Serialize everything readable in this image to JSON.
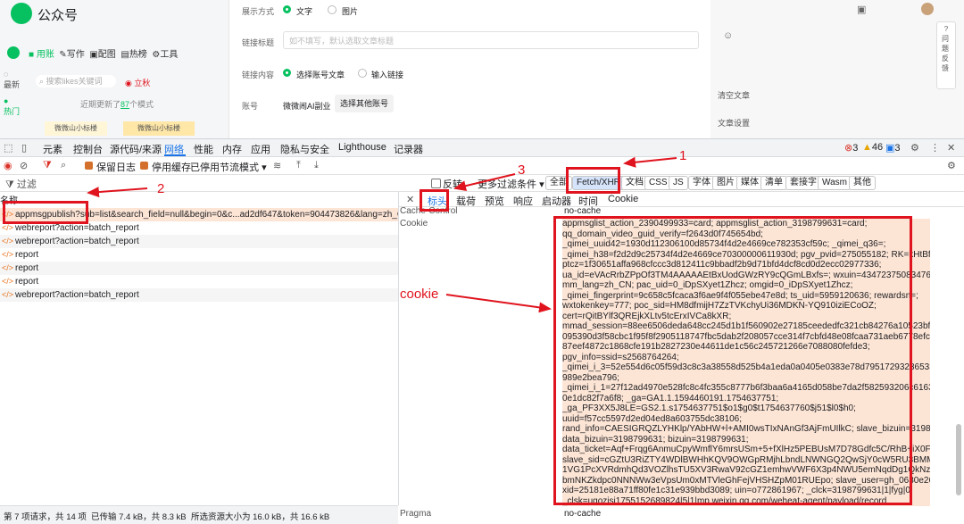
{
  "page": {
    "app_title": "公众号",
    "nav": [
      "用账",
      "写作",
      "配图",
      "热榜",
      "工具"
    ],
    "sidebar": [
      "最新",
      "热门"
    ],
    "search_placeholder": "搜索likes关键词",
    "upvote": "立秋",
    "recent_update_prefix": "近期更新了",
    "recent_update_count": "87",
    "recent_update_suffix": "个模式",
    "promo_a": "微微山小标楼",
    "promo_b": "微微山小标楼",
    "form": {
      "display_label": "展示方式",
      "display_opt1": "文字",
      "display_opt2": "图片",
      "link_title_label": "链接标题",
      "link_title_placeholder": "如不填写，默认选取文章标题",
      "link_content_label": "链接内容",
      "link_content_opt1": "选择账号文章",
      "link_content_opt2": "输入链接",
      "account_label": "账号",
      "account_value": "微微闹AI副业",
      "select_account_btn": "选择其他账号"
    },
    "right": {
      "btn1": "清空文章",
      "btn2": "文章设置"
    },
    "feedback": "问题反馈"
  },
  "devtools": {
    "tabs": [
      "元素",
      "控制台",
      "源代码/来源",
      "网络",
      "性能",
      "内存",
      "应用",
      "隐私与安全",
      "Lighthouse",
      "记录器"
    ],
    "active_tab": "网络",
    "errors": "3",
    "warnings": "46",
    "info": "3",
    "toolbar2": {
      "preserve_log": "保留日志",
      "disable_cache": "停用缓存",
      "throttle": "已停用节流模式"
    },
    "filter_placeholder": "过滤",
    "invert": "反转",
    "more_filters": "更多过滤条件",
    "chips": [
      "全部",
      "Fetch/XHR",
      "文档",
      "CSS",
      "JS",
      "字体",
      "图片",
      "媒体",
      "清单",
      "套接字",
      "Wasm",
      "其他"
    ],
    "name_header": "名称",
    "requests": [
      "appmsgpublish?sub=list&search_field=null&begin=0&c...ad2df647&token=904473826&lang=zh_CN&f...",
      "webreport?action=batch_report",
      "webreport?action=batch_report",
      "report",
      "report",
      "report",
      "webreport?action=batch_report"
    ],
    "detail_tabs": [
      "标头",
      "载荷",
      "预览",
      "响应",
      "启动器",
      "时间",
      "Cookie"
    ],
    "cache_control_label": "Cache-Control",
    "cache_control_value": "no-cache",
    "cookie_label": "Cookie",
    "cookie_lines": [
      "appmsglist_action_2390499933=card; appmsglist_action_3198799631=card;",
      "qq_domain_video_guid_verify=f2643d0f745654bd;",
      "_qimei_uuid42=1930d112306100d85734f4d2e4669ce782353cf59c; _qimei_q36=;",
      "_qimei_h38=f2d2d9c25734f4d2e4669ce70300000611930d; pgv_pvid=275055182; RK=kHtBfRgadq;",
      "ptcz=1f30651affa968cfccc3d812411c9bbadf2b9d71bfd4dcf8cd0d2ecc02977336;",
      "ua_id=eVAcRrbZPpOf3TM4AAAAAEtBxUodGWzRY9cQGmLBxfs=; wxuin=43472375083476;",
      "mm_lang=zh_CN; pac_uid=0_iDpSXyet1Zhcz; omgid=0_iDpSXyet1Zhcz;",
      "_qimei_fingerprint=9c658c5fcaca3f6ae9f4f055ebe47e8d; ts_uid=5959120636; rewardsn=;",
      "wxtokenkey=777; poc_sid=HM8dfmijH7ZzTVKchyUi36MDKN-YQ910iziECoOZ;",
      "cert=rQitBYlf3QREjkXLtv5tcErxIVCa8kXR;",
      "mmad_session=88ee6506deda648cc245d1b1f560902e27185ceededfc321cb84276a10523bf5e5c3f96",
      "095390d3f58cbc1f95f8f2905118747fbc5dab2f208057cce314f7cbfd48e08fcaa731aeb6778efcfc5c031",
      "87eef4872c1868cfe191b2827230e44611de1c56c245721266e7088080fefde3;",
      "pgv_info=ssid=s2568764264;",
      "_qimei_i_3=52e554d6c05f59d3c8c3a38558d525b4a1eda0a0405e0383e78d795172932365331369 73",
      "989e2bea796;",
      "_qimei_i_1=27f12ad4970e528fc8c4fc355c8777b6f3baa6a4165d058be7da2f582593206c6163194398",
      "0e1dc82f7a6f8; _ga=GA1.1.1594460191.1754637751;",
      "_ga_PF3XX5J8LE=GS2.1.s1754637751$o1$g0$t1754637760$j51$l0$h0;",
      "uuid=f57cc5597d2ed04ed8a603755dc38106;",
      "rand_info=CAESIGRQZLYHKlp/YAbHW+l+AMI0wsTIxNAnGf3AjFmUIlkC; slave_bizuin=3198799631;",
      "data_bizuin=3198799631; bizuin=3198799631;",
      "data_ticket=Aqf+Frqg6AnmuCpyWmflY6mrsUSm+5+fXlHz5PEBUsM7D78Gdfc5C/RhB+iX0F9y;",
      "slave_sid=cGZtU3RiZTY4WDlBWHhKQV9OWGpRMjhLbndLNWNGQ2QwSjY0cW5RU3BMMlkwU2lMWDU",
      "1VG1PcXVRdmhQd3VOZlhsTU5XV3RwaV92cGZ1emhwVWF6X3p4NWU5emNqdDg1QkNzT3c4FA4SXhC",
      "bmNKZkdpc0NNNWw3eVpsUm0xMTVleGhFejVHSHZpM01RUEpo; slave_user=gh_0630e26cb29c;",
      "xid=25181e88a71ff80fe1c31e939bbd3089; uin=o772861967; _clck=3198799631|1|fyg|0;",
      "_clsk=ugozisj1755152689824|5|1|mp.weixin.qq.com/weheat-agent/payload/record"
    ],
    "pragma_label": "Pragma",
    "pragma_value": "no-cache",
    "status_bar": [
      "第 7 项请求，共 14 项",
      "已传输 7.4 kB，共 8.3 kB",
      "所选资源大小为 16.0 kB，共 16.6 kB"
    ]
  },
  "annotations": {
    "num1": "1",
    "num2": "2",
    "num3": "3",
    "cookie": "cookie"
  },
  "colors": {
    "accent_red": "#e0141e",
    "brand_green": "#07c160",
    "devtools_blue": "#1a73e8"
  }
}
